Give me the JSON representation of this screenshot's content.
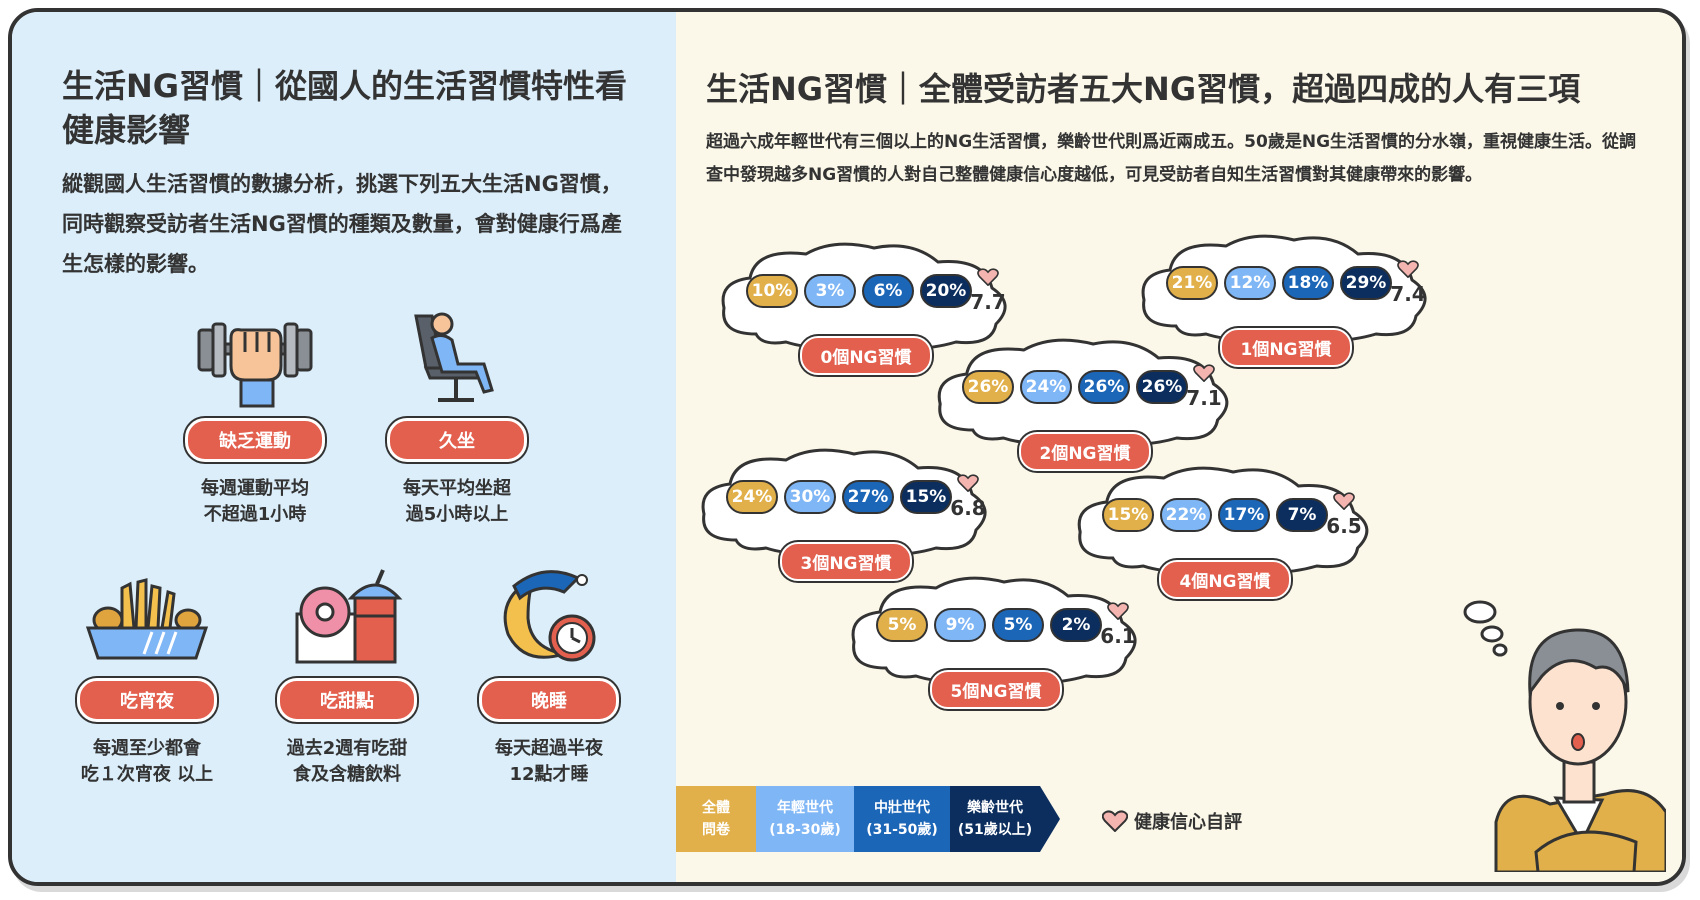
{
  "left": {
    "title": "生活NG習慣｜從國人的生活習慣特性看健康影響",
    "description": "縱觀國人生活習慣的數據分析，挑選下列五大生活NG習慣，同時觀察受訪者生活NG習慣的種類及數量，會對健康行爲產生怎樣的影響。",
    "habits": [
      {
        "label": "缺乏運動",
        "desc1": "每週運動平均",
        "desc2": "不超過1小時",
        "icon": "dumbbell-fist-icon"
      },
      {
        "label": "久坐",
        "desc1": "每天平均坐超",
        "desc2": "過5小時以上",
        "icon": "sitting-person-icon"
      },
      {
        "label": "吃宵夜",
        "desc1": "每週至少都會",
        "desc2": "吃１次宵夜 以上",
        "icon": "fries-tray-icon"
      },
      {
        "label": "吃甜點",
        "desc1": "過去2週有吃甜",
        "desc2": "食及含糖飲料",
        "icon": "donut-drink-icon"
      },
      {
        "label": "晚睡",
        "desc1": "每天超過半夜",
        "desc2": "12點才睡",
        "icon": "moon-clock-icon"
      }
    ]
  },
  "right": {
    "title": "生活NG習慣｜全體受訪者五大NG習慣，超過四成的人有三項",
    "description": "超過六成年輕世代有三個以上的NG生活習慣，樂齡世代則爲近兩成五。50歲是NG生活習慣的分水嶺，重視健康生活。從調查中發現越多NG習慣的人對自己整體健康信心度越低，可見受訪者自知生活習慣對其健康帶來的影響。"
  },
  "chart_data": {
    "type": "table",
    "series_names": [
      "全體問卷",
      "年輕世代(18-30歲)",
      "中壯世代(31-50歲)",
      "樂齡世代(51歲以上)"
    ],
    "rows": [
      {
        "label": "0個NG習慣",
        "values": [
          "10%",
          "3%",
          "6%",
          "20%"
        ],
        "score": "7.7"
      },
      {
        "label": "1個NG習慣",
        "values": [
          "21%",
          "12%",
          "18%",
          "29%"
        ],
        "score": "7.4"
      },
      {
        "label": "2個NG習慣",
        "values": [
          "26%",
          "24%",
          "26%",
          "26%"
        ],
        "score": "7.1"
      },
      {
        "label": "3個NG習慣",
        "values": [
          "24%",
          "30%",
          "27%",
          "15%"
        ],
        "score": "6.8"
      },
      {
        "label": "4個NG習慣",
        "values": [
          "15%",
          "22%",
          "17%",
          "7%"
        ],
        "score": "6.5"
      },
      {
        "label": "5個NG習慣",
        "values": [
          "5%",
          "9%",
          "5%",
          "2%"
        ],
        "score": "6.1"
      }
    ],
    "score_label": "健康信心自評",
    "colors": [
      "#e1b04a",
      "#7fb6f5",
      "#1c66b8",
      "#0b2e5f"
    ]
  },
  "legend": {
    "items": [
      {
        "line1": "全體",
        "line2": "問卷",
        "color": "#e1b04a"
      },
      {
        "line1": "年輕世代",
        "line2": "(18-30歲)",
        "color": "#7fb6f5"
      },
      {
        "line1": "中壯世代",
        "line2": "(31-50歲)",
        "color": "#1c66b8"
      },
      {
        "line1": "樂齡世代",
        "line2": "(51歲以上)",
        "color": "#0b2e5f"
      }
    ],
    "heart_label": "健康信心自評"
  }
}
